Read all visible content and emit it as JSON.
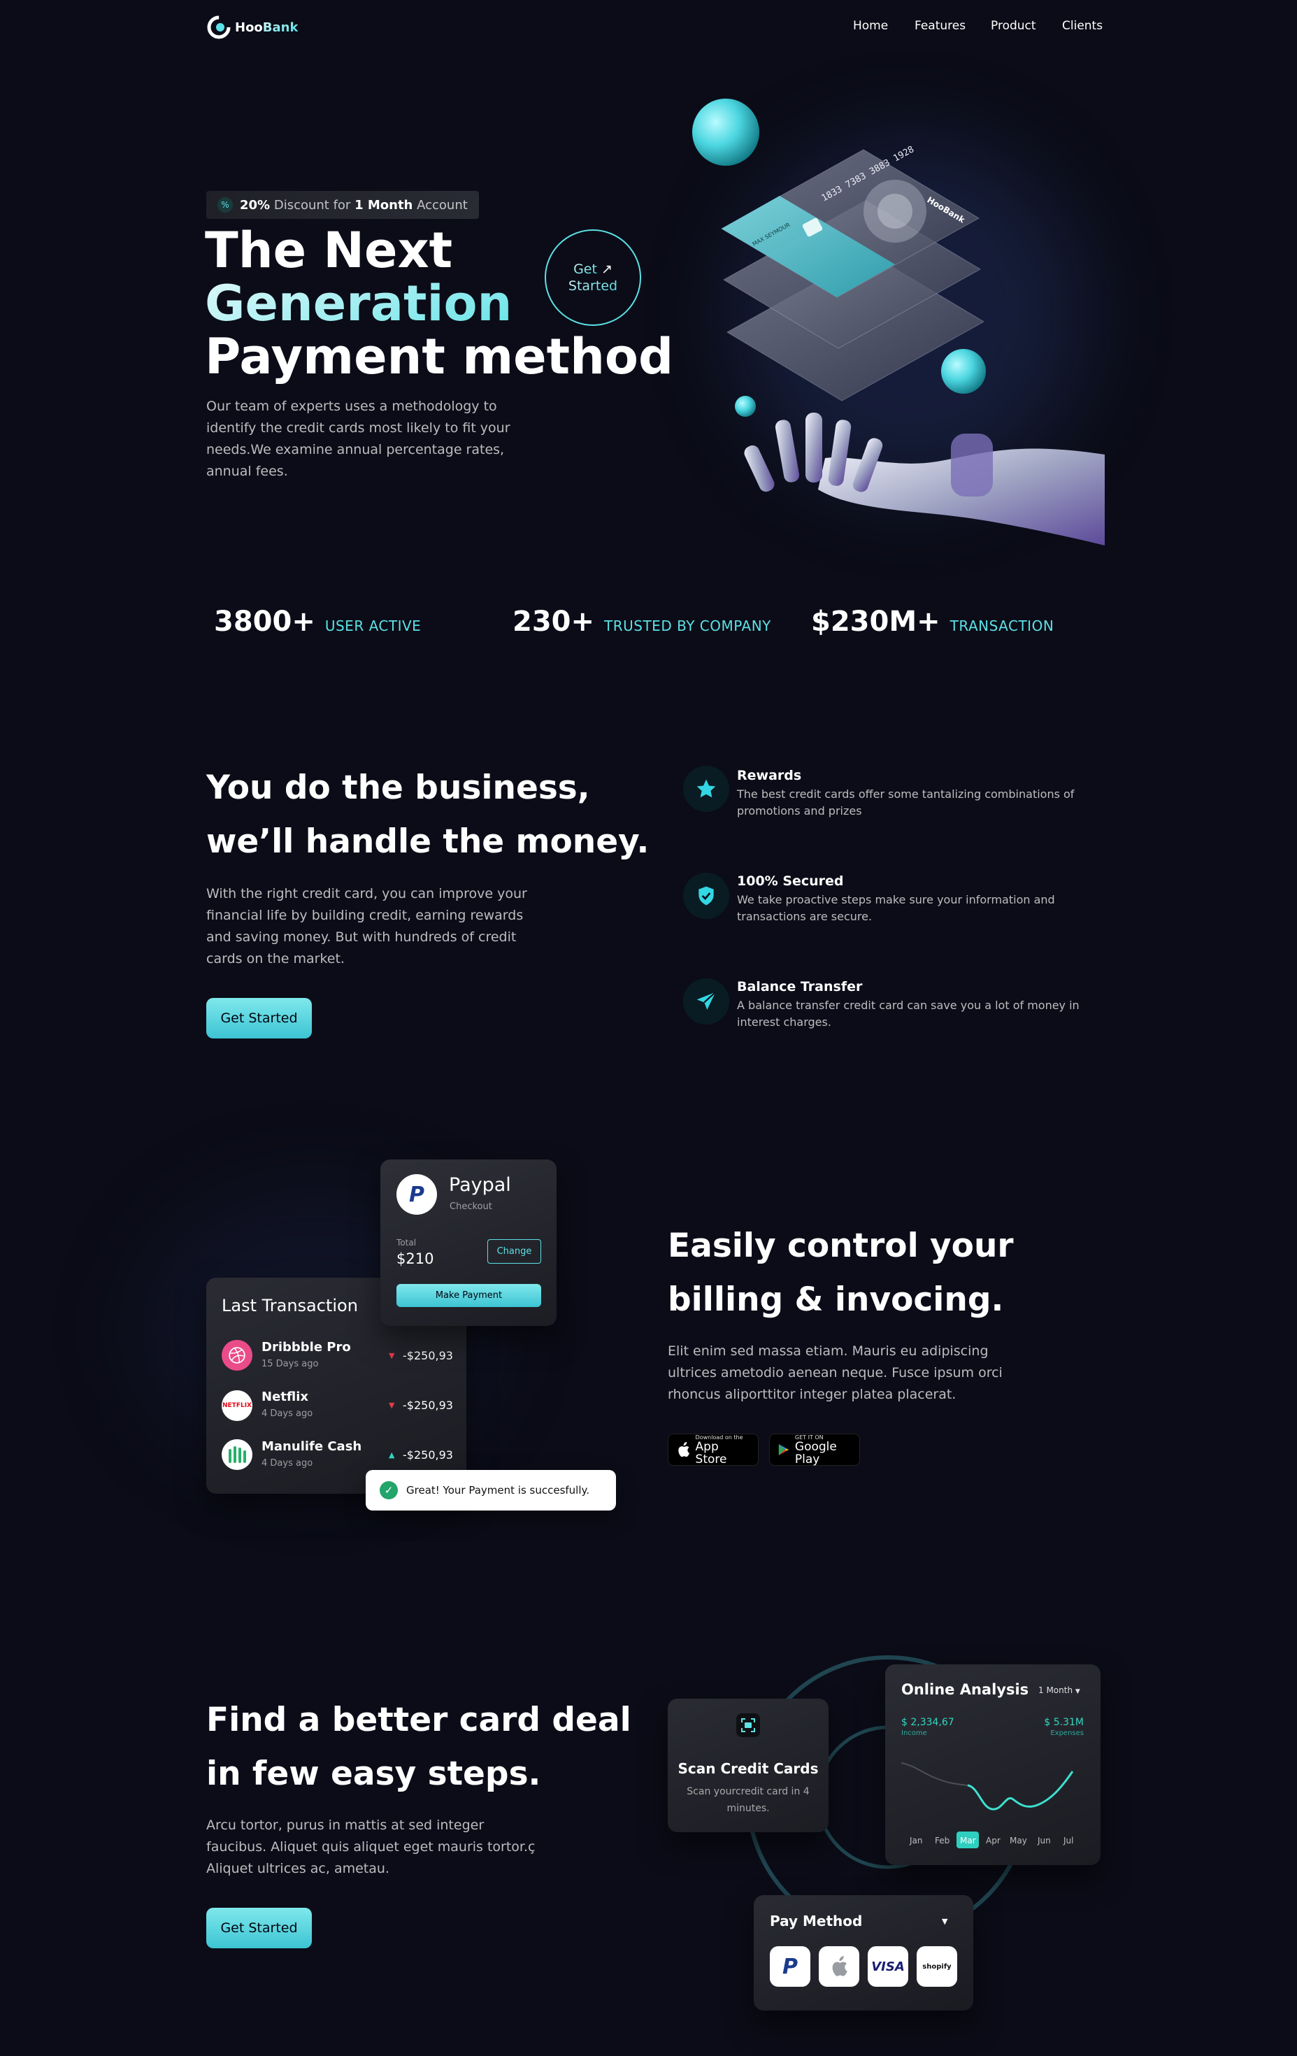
{
  "brand": {
    "name_prefix": "Hoo",
    "name_suffix": "Bank"
  },
  "nav": {
    "items": [
      "Home",
      "Features",
      "Product",
      "Clients"
    ]
  },
  "hero": {
    "badge_percent": "20%",
    "badge_text_1": "Discount for",
    "badge_bold": "1 Month",
    "badge_text_2": "Account",
    "title_line1": "The Next",
    "title_line2": "Generation",
    "title_line3": "Payment method",
    "description": "Our team of experts uses a methodology to identify the credit cards most likely to fit your needs.We examine annual percentage rates, annual fees.",
    "cta_line1": "Get",
    "cta_line2": "Started",
    "card_number": "1833 7383 3883 1928",
    "card_holder": "MAX SEYMOUR"
  },
  "stats": [
    {
      "value": "3800+",
      "label": "USER ACTIVE"
    },
    {
      "value": "230+",
      "label": "TRUSTED BY COMPANY"
    },
    {
      "value": "$230M+",
      "label": "TRANSACTION"
    }
  ],
  "business": {
    "title_line1": "You do the business,",
    "title_line2": "we’ll handle the money.",
    "description": "With the right credit card, you can improve your financial life by building credit, earning rewards and saving money. But with hundreds of credit cards on the market.",
    "cta": "Get Started",
    "features": [
      {
        "icon": "star-icon",
        "title": "Rewards",
        "description": "The best credit cards offer some tantalizing combinations of promotions and prizes"
      },
      {
        "icon": "shield-icon",
        "title": "100% Secured",
        "description": "We take proactive steps make sure your information and transactions are secure."
      },
      {
        "icon": "send-icon",
        "title": "Balance Transfer",
        "description": "A balance transfer credit card can save you a lot of money in interest charges."
      }
    ]
  },
  "billing": {
    "paypal_card": {
      "title": "Paypal",
      "subtitle": "Checkout",
      "total_label": "Total",
      "total_value": "$210",
      "change": "Change",
      "make_payment": "Make Payment"
    },
    "transactions_title": "Last Transaction",
    "transactions": [
      {
        "name": "Dribbble Pro",
        "date": "15 Days ago",
        "amount": "-$250,93",
        "direction": "down"
      },
      {
        "name": "Netflix",
        "date": "4 Days ago",
        "amount": "-$250,93",
        "direction": "down"
      },
      {
        "name": "Manulife Cash",
        "date": "4 Days ago",
        "amount": "-$250,93",
        "direction": "up"
      }
    ],
    "netflix_logo_text": "NETFLIX",
    "toast": "Great! Your Payment is succesfully.",
    "title_line1": "Easily control your",
    "title_line2": "billing & invocing.",
    "description": "Elit enim sed massa etiam. Mauris eu adipiscing ultrices ametodio aenean neque. Fusce ipsum orci rhoncus aliporttitor integer platea placerat.",
    "app_store_small": "Download on the",
    "app_store_big": "App Store",
    "google_play_small": "GET IT ON",
    "google_play_big": "Google Play"
  },
  "card_deal": {
    "title_line1": "Find a better card deal",
    "title_line2": "in few easy steps.",
    "description": "Arcu tortor, purus in mattis at sed integer faucibus. Aliquet quis aliquet eget mauris tortor.ç Aliquet ultrices ac, ametau.",
    "cta": "Get Started",
    "scan_card": {
      "title": "Scan Credit Cards",
      "description": "Scan yourcredit card in 4 minutes."
    },
    "analysis": {
      "title": "Online Analysis",
      "period": "1 Month",
      "income_value": "$ 2,334,67",
      "income_label": "Income",
      "expenses_value": "$ 5.31M",
      "expenses_label": "Expenses",
      "months": [
        "Jan",
        "Feb",
        "Mar",
        "Apr",
        "May",
        "Jun",
        "Jul"
      ],
      "active_month": "Mar"
    },
    "pay_method": {
      "title": "Pay Method",
      "logos": [
        "paypal-logo",
        "apple-logo",
        "visa-logo",
        "shopify-logo"
      ],
      "visa_text": "VISA",
      "shopify_text": "shopify"
    }
  },
  "colors": {
    "background": "#0b0c17",
    "accent": "#5ce1e6",
    "accent_dark": "#33bbcf"
  }
}
